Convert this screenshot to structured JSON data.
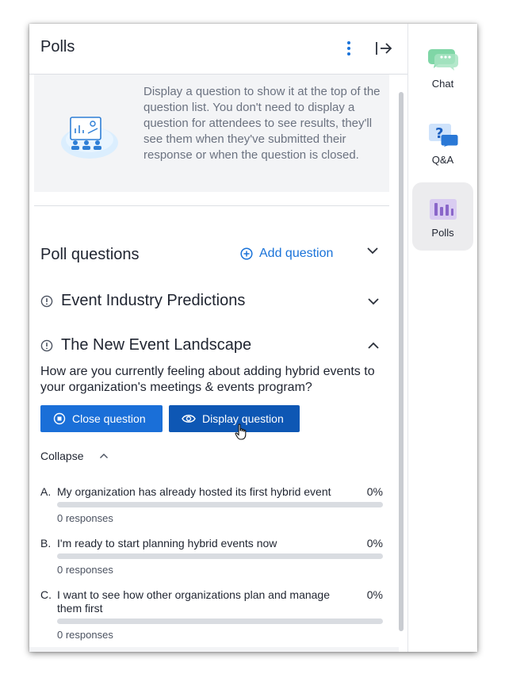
{
  "header": {
    "title": "Polls"
  },
  "info": {
    "text": "Display a question to show it at the top of the question list. You don't need to display a question for attendees to see results, they'll see them when they've submitted their response or when the question is closed."
  },
  "poll_questions": {
    "title": "Poll questions",
    "add_label": "Add question"
  },
  "questions": [
    {
      "title": "Event Industry Predictions",
      "expanded": false
    },
    {
      "title": "The New Event Landscape",
      "expanded": true
    }
  ],
  "active_question": {
    "text": "How are you currently feeling about adding hybrid events to your organization's meetings & events program?",
    "close_button": "Close question",
    "display_button": "Display question",
    "collapse_label": "Collapse",
    "options": [
      {
        "letter": "A.",
        "label": "My organization has already hosted its first hybrid event",
        "percent": "0%",
        "responses": "0 responses",
        "fill": 0
      },
      {
        "letter": "B.",
        "label": "I'm ready to start planning hybrid events now",
        "percent": "0%",
        "responses": "0 responses",
        "fill": 0
      },
      {
        "letter": "C.",
        "label": "I want to see how other organizations plan and manage them first",
        "percent": "0%",
        "responses": "0 responses",
        "fill": 0
      }
    ]
  },
  "rail": {
    "items": [
      {
        "label": "Chat",
        "icon": "chat-icon"
      },
      {
        "label": "Q&A",
        "icon": "qa-icon"
      },
      {
        "label": "Polls",
        "icon": "polls-icon",
        "active": true
      }
    ]
  },
  "colors": {
    "accent": "#1a73d9",
    "button_primary": "#1a6fd8",
    "button_dark": "#0e57b4",
    "chat_green": "#7fd6a6",
    "polls_purple": "#9b7fd0"
  }
}
